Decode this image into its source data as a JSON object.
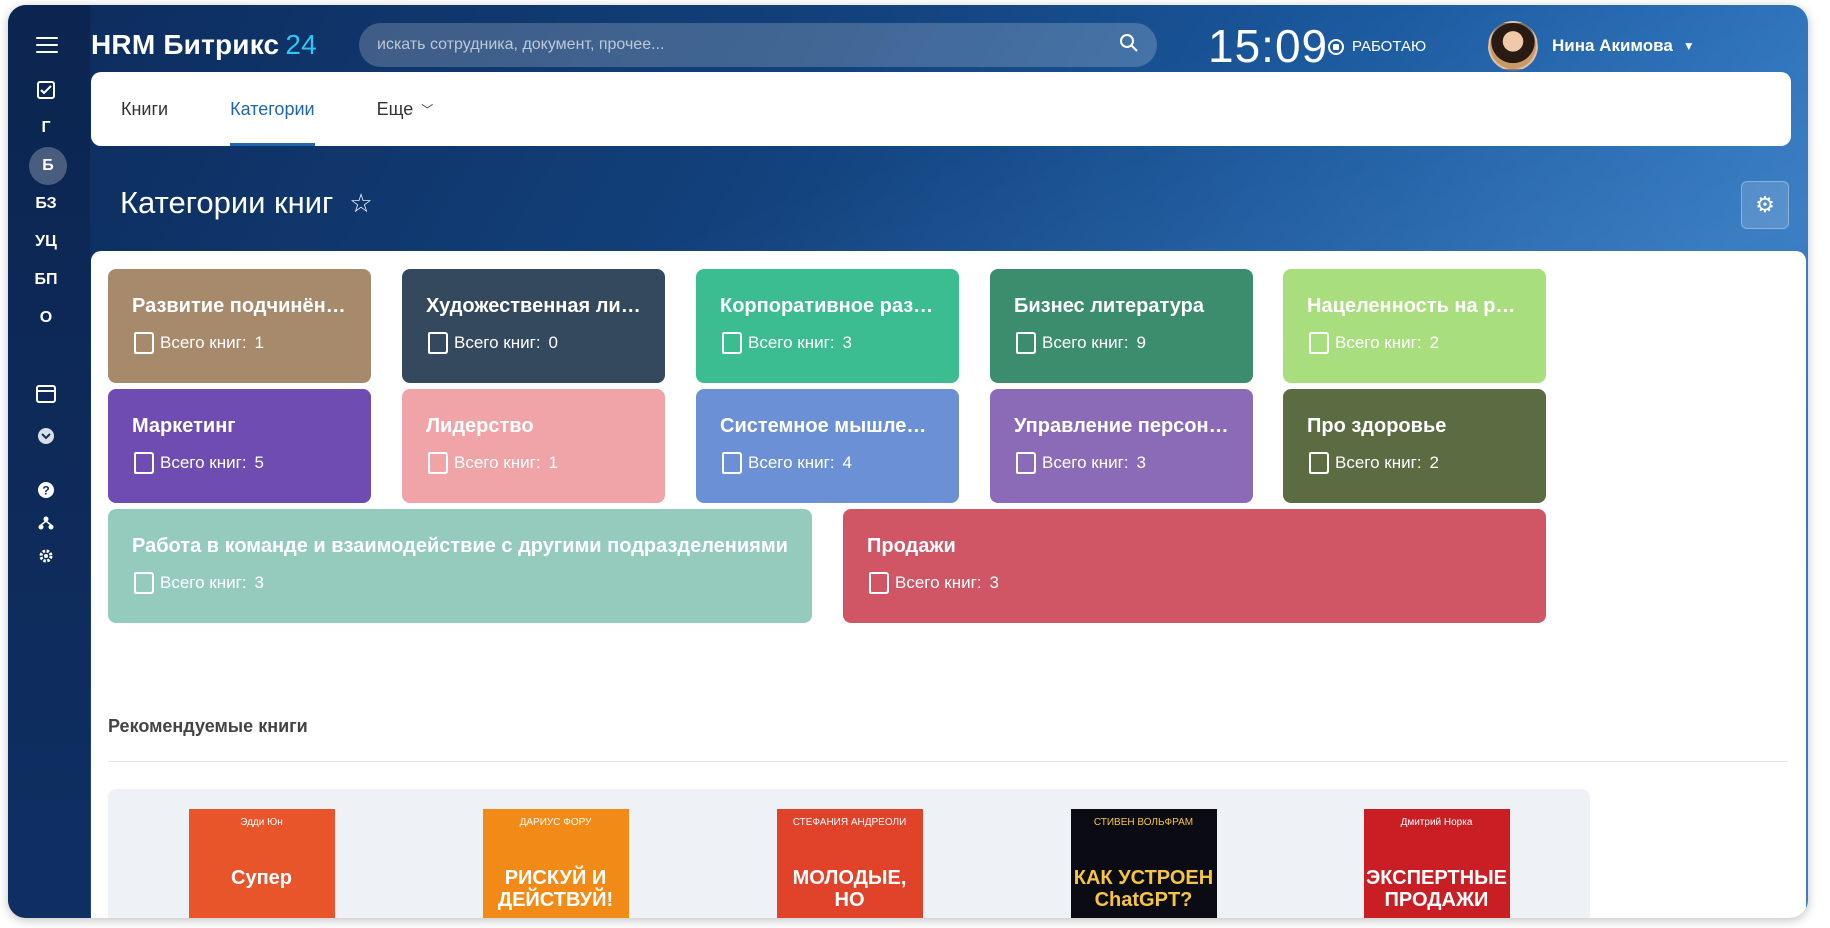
{
  "app": {
    "name": "HRM Битрикс",
    "num": "24"
  },
  "search": {
    "placeholder": "искать сотрудника, документ, прочее..."
  },
  "clock": "15:09",
  "status": "РАБОТАЮ",
  "user": {
    "name": "Нина Акимова"
  },
  "rail": [
    "Г",
    "Б",
    "БЗ",
    "УЦ",
    "БП",
    "О"
  ],
  "tabs": [
    {
      "label": "Книги"
    },
    {
      "label": "Категории"
    },
    {
      "label": "Еще"
    }
  ],
  "page_title": "Категории книг",
  "count_label": "Всего книг:",
  "categories": [
    {
      "title": "Развитие подчинённых",
      "count": "1",
      "color": "#a68a6b"
    },
    {
      "title": "Художественная лите...",
      "count": "0",
      "color": "#34495e"
    },
    {
      "title": "Корпоративное разви...",
      "count": "3",
      "color": "#3bbd91"
    },
    {
      "title": "Бизнес литература",
      "count": "9",
      "color": "#3b8d6e"
    },
    {
      "title": "Нацеленность на резу...",
      "count": "2",
      "color": "#a9de7f"
    },
    {
      "title": "Маркетинг",
      "count": "5",
      "color": "#6e4cb2"
    },
    {
      "title": "Лидерство",
      "count": "1",
      "color": "#f0a4a7"
    },
    {
      "title": "Системное мышление",
      "count": "4",
      "color": "#6c90d5"
    },
    {
      "title": "Управление персонал...",
      "count": "3",
      "color": "#8b6ab7"
    },
    {
      "title": "Про здоровье",
      "count": "2",
      "color": "#5b6b42"
    },
    {
      "title": "Работа в команде и взаимодействие с другими подразделениями",
      "count": "3",
      "color": "#94cbbd"
    },
    {
      "title": "Продажи",
      "count": "3",
      "color": "#d05565"
    }
  ],
  "recommended": {
    "title": "Рекомендуемые книги",
    "books": [
      {
        "cover_text_top": "Эдди Юн",
        "cover_text": "Супер",
        "color": "#e8552b"
      },
      {
        "cover_text_top": "ДАРИУС ФОРУ",
        "cover_text": "РИСКУЙ И ДЕЙСТВУЙ!",
        "color": "#f28a17"
      },
      {
        "cover_text_top": "СТЕФАНИЯ АНДРЕОЛИ",
        "cover_text": "МОЛОДЫЕ, НО",
        "color": "#e0432a"
      },
      {
        "cover_text_top": "СТИВЕН ВОЛЬФРАМ",
        "cover_text": "КАК УСТРОЕН ChatGPT?",
        "color": "#0b0b14"
      },
      {
        "cover_text_top": "Дмитрий Норка",
        "cover_text": "ЭКСПЕРТНЫЕ ПРОДАЖИ",
        "color": "#c81e24"
      }
    ]
  }
}
